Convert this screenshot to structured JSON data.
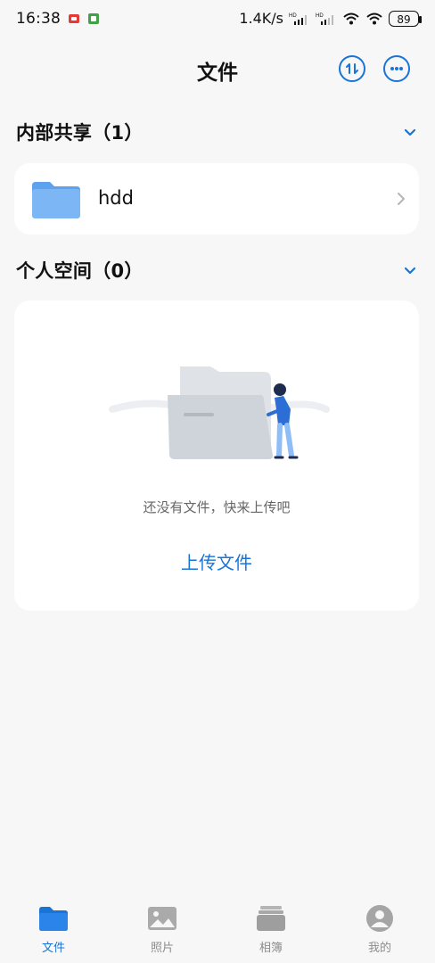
{
  "status_bar": {
    "time": "16:38",
    "speed": "1.4K/s",
    "battery": "89"
  },
  "header": {
    "title": "文件",
    "transfer_icon": "transfer-icon",
    "more_icon": "more-icon"
  },
  "sections": {
    "internal_share": {
      "title": "内部共享（1）",
      "folders": [
        {
          "name": "hdd"
        }
      ]
    },
    "personal_space": {
      "title": "个人空间（0）",
      "empty_text": "还没有文件，快来上传吧",
      "upload_label": "上传文件"
    }
  },
  "bottom_nav": {
    "items": [
      {
        "label": "文件",
        "icon": "folder-icon",
        "active": true
      },
      {
        "label": "照片",
        "icon": "photo-icon",
        "active": false
      },
      {
        "label": "相簿",
        "icon": "album-icon",
        "active": false
      },
      {
        "label": "我的",
        "icon": "profile-icon",
        "active": false
      }
    ]
  },
  "colors": {
    "accent": "#1a74d6",
    "background": "#f7f7f7",
    "card": "#ffffff",
    "muted_text": "#666666"
  }
}
